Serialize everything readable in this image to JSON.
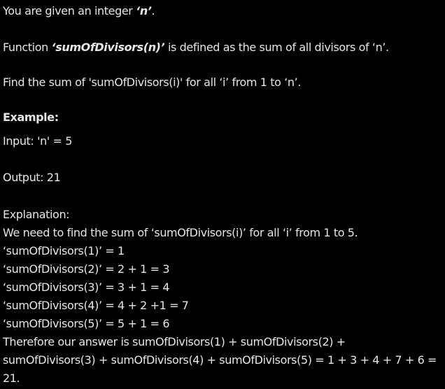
{
  "intro": {
    "line1_prefix": "You are given an integer ",
    "line1_var": "‘n’",
    "line1_suffix": ".",
    "line2_prefix": "Function ",
    "line2_func": "‘sumOfDivisors(n)’",
    "line2_suffix": " is defined as the sum of all divisors of ‘n’.",
    "line3": "Find the sum of 'sumOfDivisors(i)' for all ‘i’ from 1 to ‘n’."
  },
  "example": {
    "heading": "Example:",
    "input": "Input: 'n'  = 5",
    "output": "Output: 21",
    "explanation_heading": "Explanation:",
    "explanation_lines": [
      "We need to find the sum of ‘sumOfDivisors(i)’ for all ‘i’ from 1 to 5.",
      "‘sumOfDivisors(1)’ = 1",
      "‘sumOfDivisors(2)’ = 2 + 1 = 3",
      "‘sumOfDivisors(3)’ = 3 + 1 = 4",
      "‘sumOfDivisors(4)’ = 4 + 2 +1 = 7",
      "‘sumOfDivisors(5)’ = 5 + 1 = 6",
      "Therefore our answer is sumOfDivisors(1) + sumOfDivisors(2) +",
      "sumOfDivisors(3) + sumOfDivisors(4) + sumOfDivisors(5) = 1 + 3 + 4 + 7 + 6 =",
      "21."
    ]
  }
}
